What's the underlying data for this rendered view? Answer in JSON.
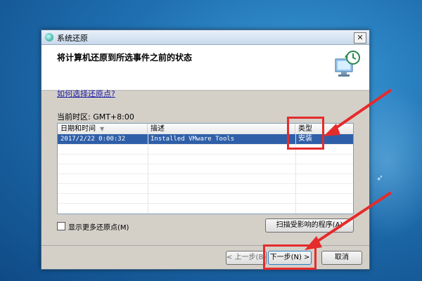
{
  "window": {
    "title": "系统还原",
    "close_glyph": "✕",
    "heading": "将计算机还原到所选事件之前的状态",
    "header_icon": "computer-restore-icon"
  },
  "help_link": "如何选择还原点?",
  "timezone": "当前时区: GMT+8:00",
  "table": {
    "columns": [
      "日期和时间",
      "描述",
      "类型"
    ],
    "sort_glyph": "▼",
    "rows": [
      {
        "datetime": "2017/2/22 0:00:32",
        "description": "Installed VMware Tools",
        "type": "安装",
        "selected": true
      }
    ]
  },
  "show_more_label": "显示更多还原点(M)",
  "buttons": {
    "scan": "扫描受影响的程序(A)",
    "back": "< 上一步(B)",
    "next": "下一步(N) >",
    "cancel": "取消"
  },
  "annotation_color": "#e52b2b",
  "selection_color": "#2f5fa8"
}
